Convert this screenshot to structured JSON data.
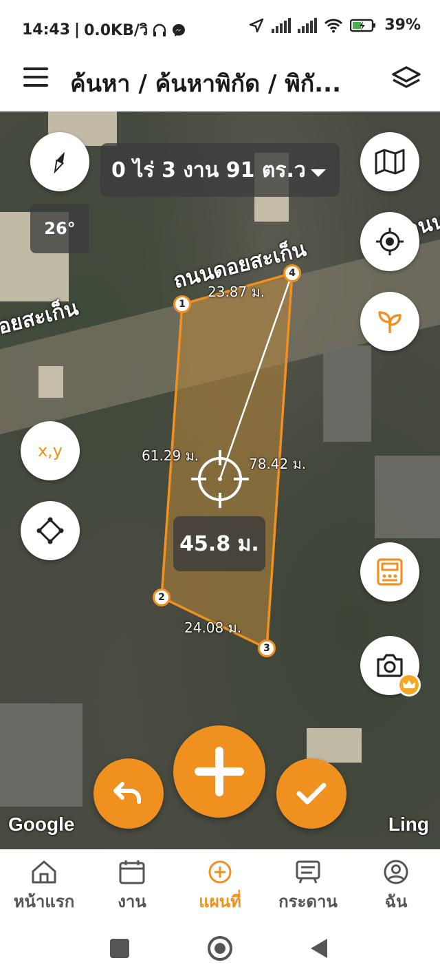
{
  "status_bar": {
    "time": "14:43",
    "network_speed": "0.0KB/วิ",
    "battery": "39%"
  },
  "header": {
    "title": "ค้นหา / ค้นหาพิกัด / พิกั..."
  },
  "map": {
    "area_text": "0 ไร่ 3 งาน 91 ตร.ว",
    "rotation": "26°",
    "road_label_main": "ถนนดอยสะเก็น",
    "road_label_left": "อยสะเก็น",
    "road_label_right": "ถนน",
    "coord_button_label": "x,y",
    "center_distance": "45.8 ม.",
    "segments": {
      "top": "23.87 ม.",
      "left": "61.29 ม.",
      "right": "78.42 ม.",
      "bottom": "24.08 ม."
    },
    "vertices": [
      "1",
      "2",
      "3",
      "4"
    ],
    "attribution_left": "Google",
    "attribution_right": "Ling"
  },
  "bottom_nav": {
    "items": [
      {
        "label": "หน้าแรก",
        "icon": "home-icon"
      },
      {
        "label": "งาน",
        "icon": "calendar-icon"
      },
      {
        "label": "แผนที่",
        "icon": "add-circle-icon"
      },
      {
        "label": "กระดาน",
        "icon": "board-icon"
      },
      {
        "label": "ฉัน",
        "icon": "profile-icon"
      }
    ],
    "active_index": 2
  },
  "colors": {
    "accent": "#f0901e",
    "overlay": "#3c3c3c"
  }
}
